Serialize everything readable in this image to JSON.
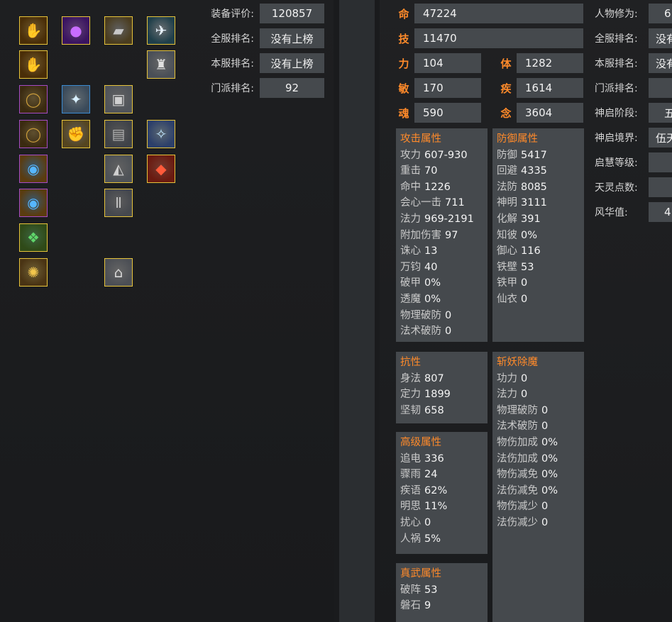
{
  "summary": {
    "equip_score": {
      "label": "装备评价:",
      "value": "120857"
    },
    "server_all_rank": {
      "label": "全服排名:",
      "value": "没有上榜"
    },
    "server_local_rank": {
      "label": "本服排名:",
      "value": "没有上榜"
    },
    "school_rank": {
      "label": "门派排名:",
      "value": "92"
    }
  },
  "equipment": [
    {
      "icon": "golden-hand-amulet-icon",
      "frame": "gold"
    },
    {
      "icon": "purple-orb-icon",
      "frame": "gold"
    },
    {
      "icon": "armored-bracer-icon",
      "frame": "gold"
    },
    {
      "icon": "white-crane-icon",
      "frame": "gold"
    },
    {
      "icon": "golden-hand-amulet-icon",
      "frame": "gold"
    },
    {
      "icon": "silver-robe-icon",
      "frame": "gold"
    },
    {
      "icon": "bronze-ring-icon",
      "frame": "purple"
    },
    {
      "icon": "feather-wing-icon",
      "frame": "blue"
    },
    {
      "icon": "chest-armor-icon",
      "frame": "gold"
    },
    {
      "icon": "bronze-ring-icon",
      "frame": "purple"
    },
    {
      "icon": "gauntlet-icon",
      "frame": "gold"
    },
    {
      "icon": "belt-armor-icon",
      "frame": "gold"
    },
    {
      "icon": "ice-crystal-weapon-icon",
      "frame": "gold"
    },
    {
      "icon": "sapphire-ring-icon",
      "frame": "purple"
    },
    {
      "icon": "shoulder-armor-icon",
      "frame": "gold"
    },
    {
      "icon": "red-lantern-icon",
      "frame": "gold"
    },
    {
      "icon": "sapphire-ring-icon",
      "frame": "purple"
    },
    {
      "icon": "leg-armor-icon",
      "frame": "gold"
    },
    {
      "icon": "jade-pendant-icon",
      "frame": "gold"
    },
    {
      "icon": "spiral-talisman-icon",
      "frame": "gold"
    },
    {
      "icon": "armored-boots-icon",
      "frame": "gold"
    }
  ],
  "base_stats": {
    "ming": {
      "label": "命",
      "value": "47224"
    },
    "ji": {
      "label": "技",
      "value": "11470"
    },
    "li": {
      "label": "力",
      "value": "104"
    },
    "ti": {
      "label": "体",
      "value": "1282"
    },
    "min": {
      "label": "敏",
      "value": "170"
    },
    "ji2": {
      "label": "疾",
      "value": "1614"
    },
    "hun": {
      "label": "魂",
      "value": "590"
    },
    "nian": {
      "label": "念",
      "value": "3604"
    }
  },
  "right_info": [
    {
      "label": "人物修为:",
      "value": "6"
    },
    {
      "label": "全服排名:",
      "value": "没有"
    },
    {
      "label": "本服排名:",
      "value": "没有"
    },
    {
      "label": "门派排名:",
      "value": ""
    },
    {
      "label": "神启阶段:",
      "value": "五"
    },
    {
      "label": "神启境界:",
      "value": "伍天"
    },
    {
      "label": "启慧等级:",
      "value": ""
    },
    {
      "label": "天灵点数:",
      "value": ""
    },
    {
      "label": "风华值:",
      "value": "4"
    }
  ],
  "attack": {
    "title": "攻击属性",
    "rows": [
      {
        "k": "攻力",
        "v": "607-930"
      },
      {
        "k": "重击",
        "v": "70"
      },
      {
        "k": "命中",
        "v": "1226"
      },
      {
        "k": "会心一击",
        "v": "711"
      },
      {
        "k": "法力",
        "v": "969-2191"
      },
      {
        "k": "附加伤害",
        "v": "97"
      },
      {
        "k": "诛心",
        "v": "13"
      },
      {
        "k": "万钧",
        "v": "40"
      },
      {
        "k": "破甲",
        "v": "0%"
      },
      {
        "k": "透魔",
        "v": "0%"
      },
      {
        "k": "物理破防",
        "v": "0"
      },
      {
        "k": "法术破防",
        "v": "0"
      }
    ]
  },
  "defense": {
    "title": "防御属性",
    "rows": [
      {
        "k": "防御",
        "v": "5417"
      },
      {
        "k": "回避",
        "v": "4335"
      },
      {
        "k": "法防",
        "v": "8085"
      },
      {
        "k": "神明",
        "v": "3111"
      },
      {
        "k": "化解",
        "v": "391"
      },
      {
        "k": "知彼",
        "v": "0%"
      },
      {
        "k": "御心",
        "v": "116"
      },
      {
        "k": "铁壁",
        "v": "53"
      },
      {
        "k": "铁甲",
        "v": "0"
      },
      {
        "k": "仙衣",
        "v": "0"
      }
    ]
  },
  "resist": {
    "title": "抗性",
    "rows": [
      {
        "k": "身法",
        "v": "807"
      },
      {
        "k": "定力",
        "v": "1899"
      },
      {
        "k": "坚韧",
        "v": "658"
      }
    ]
  },
  "demon": {
    "title": "斩妖除魔",
    "rows": [
      {
        "k": "功力",
        "v": "0"
      },
      {
        "k": "法力",
        "v": "0"
      },
      {
        "k": "物理破防",
        "v": "0"
      },
      {
        "k": "法术破防",
        "v": "0"
      },
      {
        "k": "物伤加成",
        "v": "0%"
      },
      {
        "k": "法伤加成",
        "v": "0%"
      },
      {
        "k": "物伤减免",
        "v": "0%"
      },
      {
        "k": "法伤减免",
        "v": "0%"
      },
      {
        "k": "物伤减少",
        "v": "0"
      },
      {
        "k": "法伤减少",
        "v": "0"
      }
    ]
  },
  "advanced": {
    "title": "高级属性",
    "rows": [
      {
        "k": "追电",
        "v": "336"
      },
      {
        "k": "骤雨",
        "v": "24"
      },
      {
        "k": "疾语",
        "v": "62%"
      },
      {
        "k": "明思",
        "v": "11%"
      },
      {
        "k": "扰心",
        "v": "0"
      },
      {
        "k": "人祸",
        "v": "5%"
      }
    ]
  },
  "martial": {
    "title": "真武属性",
    "rows": [
      {
        "k": "破阵",
        "v": "53"
      },
      {
        "k": "磐石",
        "v": "9"
      }
    ]
  },
  "colors": {
    "accent": "#ff8a2a",
    "box": "#45494d",
    "gold_frame": "#e6c33a",
    "purple_frame": "#a64bc5"
  }
}
